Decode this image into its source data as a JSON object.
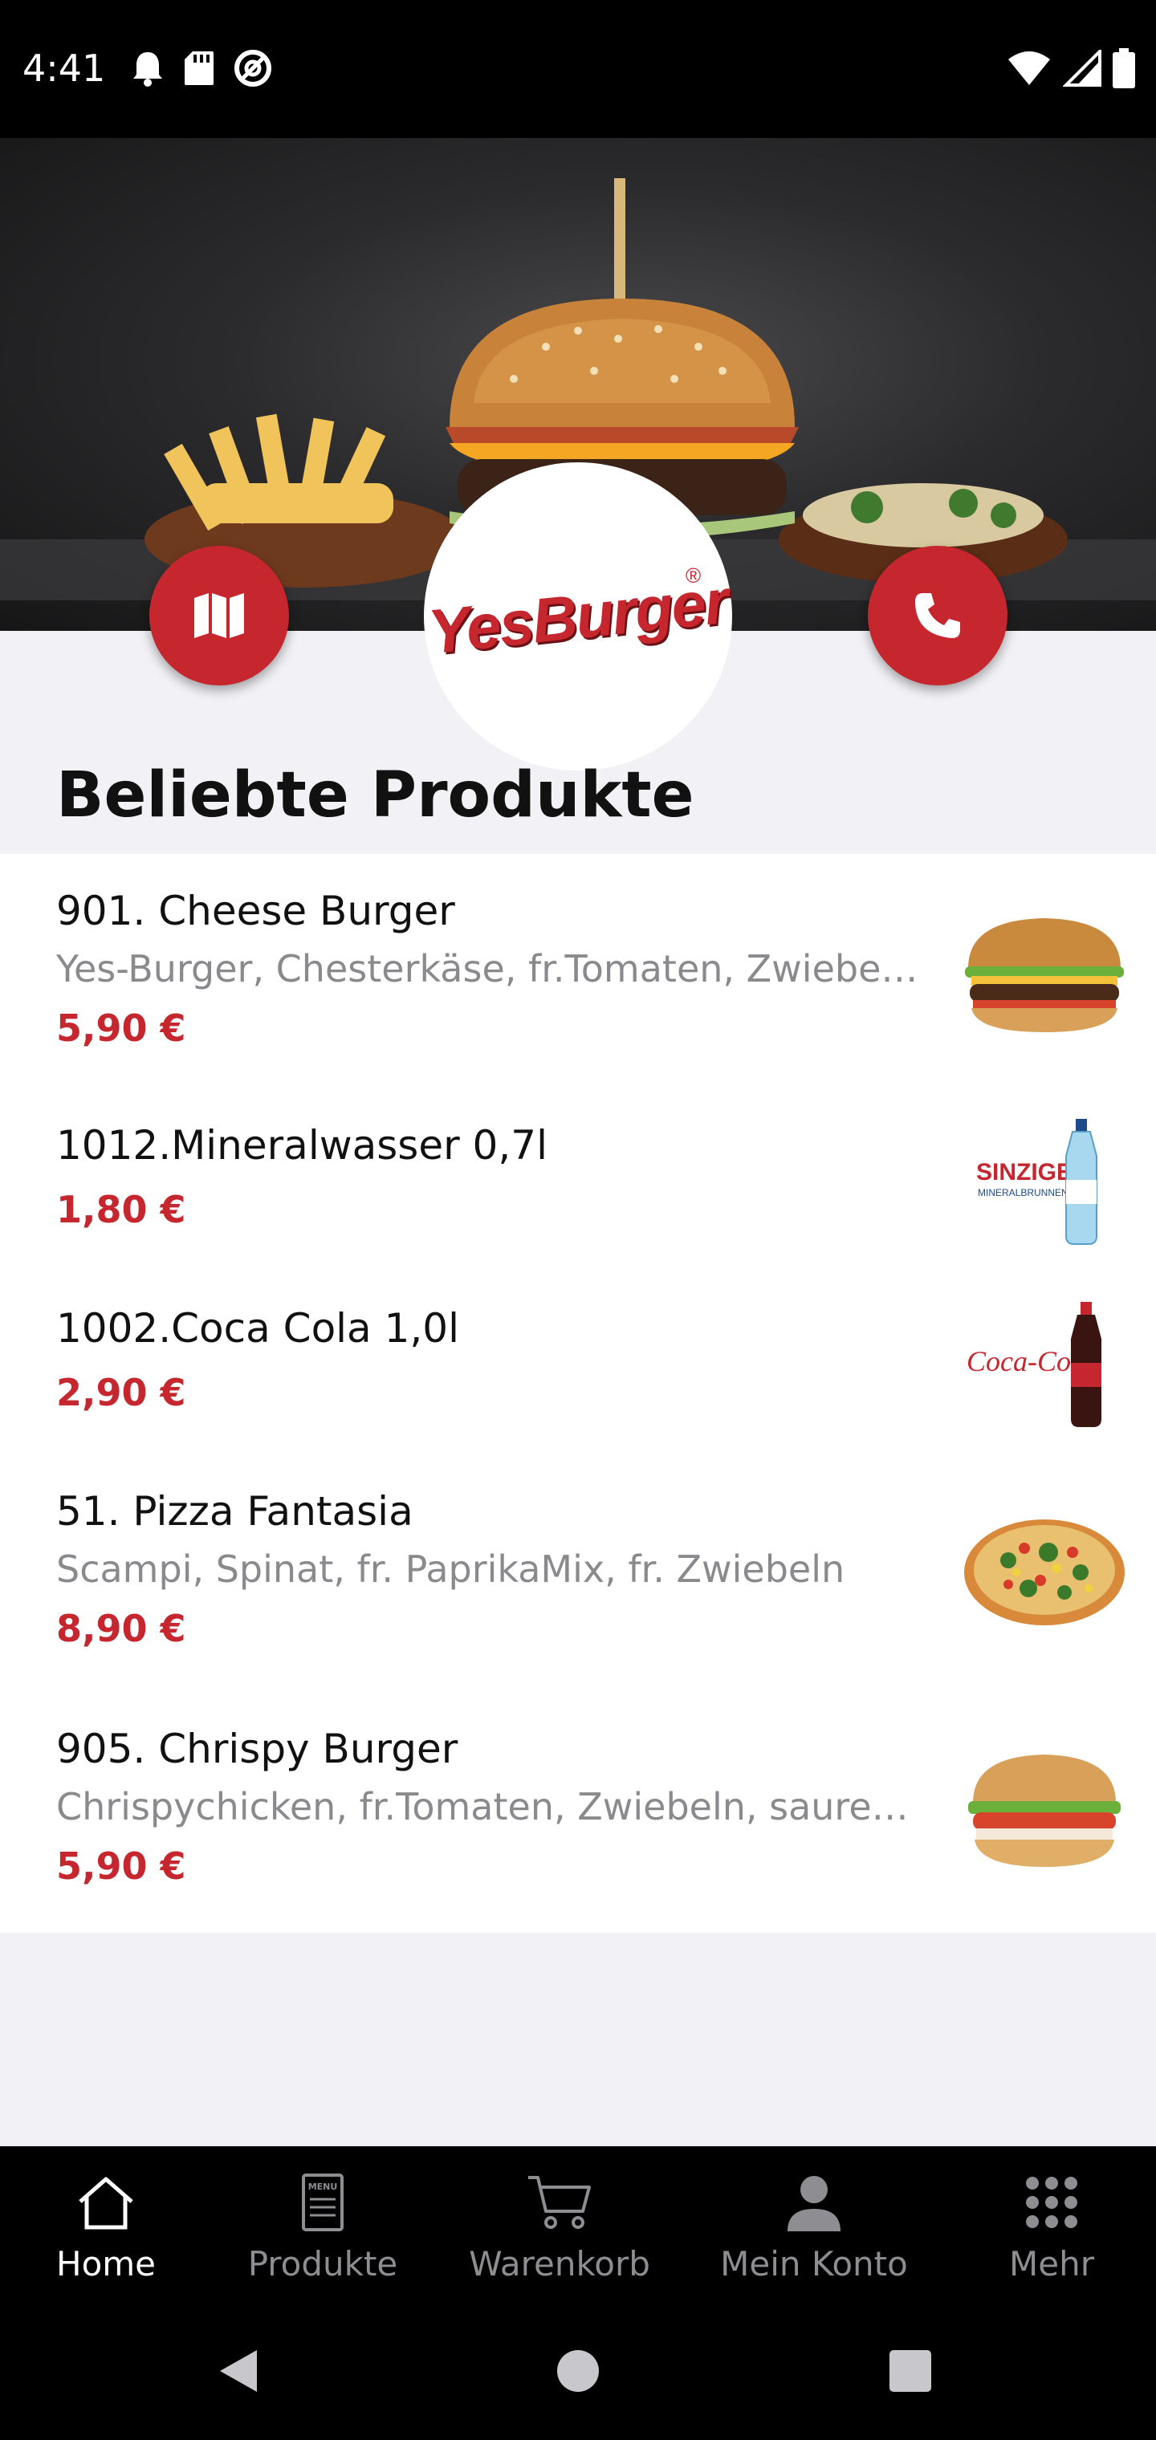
{
  "status_bar": {
    "time": "4:41",
    "left_icons": [
      "notification-bell-icon",
      "sd-card-icon",
      "do-not-disturb-icon"
    ],
    "right_icons": [
      "wifi-icon",
      "cell-signal-icon",
      "battery-icon"
    ]
  },
  "hero": {
    "image": "burger-and-fries-photo",
    "logo_text": "YesBurger",
    "logo_reg": "®",
    "map_button_icon": "map-icon",
    "phone_button_icon": "phone-icon"
  },
  "section": {
    "title": "Beliebte Produkte"
  },
  "products": [
    {
      "name": "901. Cheese Burger",
      "description": "Yes-Burger, Chesterkäse, fr.Tomaten, Zwiebeln, Salat",
      "price": "5,90 €",
      "thumb": "cheese-burger-photo"
    },
    {
      "name": "1012.Mineralwasser 0,7l",
      "description": "",
      "price": "1,80 €",
      "thumb": "mineral-water-photo"
    },
    {
      "name": "1002.Coca Cola 1,0l",
      "description": "",
      "price": "2,90 €",
      "thumb": "coca-cola-photo"
    },
    {
      "name": "51. Pizza Fantasia",
      "description": "Scampi, Spinat, fr. PaprikaMix, fr. Zwiebeln",
      "price": "8,90 €",
      "thumb": "pizza-photo"
    },
    {
      "name": "905. Chrispy Burger",
      "description": "Chrispychicken, fr.Tomaten, Zwiebeln, saure Gurken",
      "price": "5,90 €",
      "thumb": "chrispy-burger-photo"
    }
  ],
  "bottom_nav": {
    "active": "Home",
    "items": [
      {
        "label": "Home",
        "icon": "home-icon"
      },
      {
        "label": "Produkte",
        "icon": "menu-card-icon"
      },
      {
        "label": "Warenkorb",
        "icon": "cart-icon"
      },
      {
        "label": "Mein Konto",
        "icon": "user-icon"
      },
      {
        "label": "Mehr",
        "icon": "grid-dots-icon"
      }
    ]
  },
  "colors": {
    "accent": "#c6262e",
    "nav_background": "#000000",
    "page_background": "#f2f2f6"
  }
}
